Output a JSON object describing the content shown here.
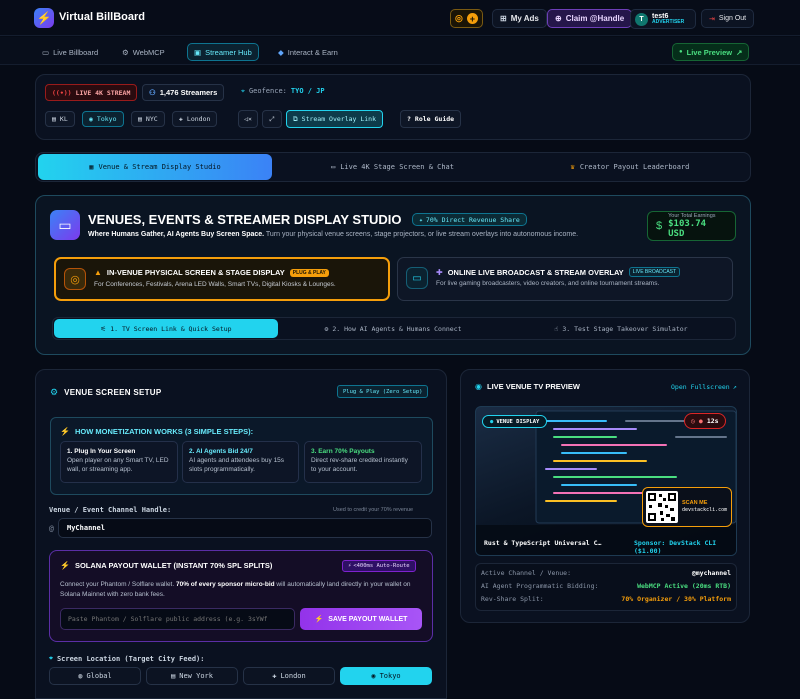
{
  "header": {
    "brand": "Virtual BillBoard",
    "my_ads": "My Ads",
    "claim": "Claim @Handle",
    "user_name": "test6",
    "user_role": "ADVERTISER",
    "user_initial": "T",
    "sign_out": "Sign Out"
  },
  "nav": {
    "items": [
      "Live Billboard",
      "WebMCP",
      "Streamer Hub",
      "Interact & Earn"
    ],
    "live_preview": "Live Preview"
  },
  "status": {
    "live": "LIVE 4K STREAM",
    "streamers": "1,476 Streamers",
    "geofence_label": "Geofence:",
    "geofence_value": "TYO / JP",
    "cities": [
      "KL",
      "Tokyo",
      "NYC",
      "London"
    ],
    "overlay_link": "Stream Overlay Link",
    "role_guide": "Role Guide"
  },
  "section_tabs": [
    "Venue & Stream Display Studio",
    "Live 4K Stage Screen & Chat",
    "Creator Payout Leaderboard"
  ],
  "studio": {
    "title": "VENUES, EVENTS & STREAMER DISPLAY STUDIO",
    "badge": "70% Direct Revenue Share",
    "subtitle_bold": "Where Humans Gather, AI Agents Buy Screen Space.",
    "subtitle_rest": " Turn your physical venue screens, stage projectors, or live stream overlays into autonomous income.",
    "earnings_label": "Your Total Earnings",
    "earnings_value": "$103.74 USD",
    "opt1_title": "IN-VENUE PHYSICAL SCREEN & STAGE DISPLAY",
    "opt1_badge": "PLUG & PLAY",
    "opt1_desc": "For Conferences, Festivals, Arena LED Walls, Smart TVs, Digital Kiosks & Lounges.",
    "opt2_title": "ONLINE LIVE BROADCAST & STREAM OVERLAY",
    "opt2_badge": "LIVE BROADCAST",
    "opt2_desc": "For live gaming broadcasters, video creators, and online tournament streams.",
    "steps": [
      "1. TV Screen Link & Quick Setup",
      "2. How AI Agents & Humans Connect",
      "3. Test Stage Takeover Simulator"
    ]
  },
  "setup": {
    "title": "VENUE SCREEN SETUP",
    "badge": "Plug & Play (Zero Setup)",
    "how_title": "HOW MONETIZATION WORKS (3 SIMPLE STEPS):",
    "steps": [
      {
        "title": "1. Plug In Your Screen",
        "desc": "Open player on any Smart TV, LED wall, or streaming app."
      },
      {
        "title": "2. AI Agents Bid 24/7",
        "desc": "AI agents and attendees buy 15s slots programmatically."
      },
      {
        "title": "3. Earn 70% Payouts",
        "desc": "Direct rev-share credited instantly to your account."
      }
    ],
    "handle_label": "Venue / Event Channel Handle:",
    "handle_hint": "Used to credit your 70% revenue",
    "handle_prefix": "@",
    "handle_value": "MyChannel",
    "wallet_title": "SOLANA PAYOUT WALLET (INSTANT 70% SPL SPLITS)",
    "wallet_badge": "<400ms Auto-Route",
    "wallet_desc_1": "Connect your Phantom / Solflare wallet. ",
    "wallet_desc_bold": "70% of every sponsor micro-bid",
    "wallet_desc_2": " will automatically land directly in your wallet on Solana Mainnet with zero bank fees.",
    "wallet_placeholder": "Paste Phantom / Solflare public address (e.g. 3sYWf",
    "save_wallet": "SAVE PAYOUT WALLET",
    "location_label": "Screen Location (Target City Feed):",
    "locations": [
      "Global",
      "New York",
      "London",
      "Tokyo"
    ]
  },
  "preview": {
    "title": "LIVE VENUE TV PREVIEW",
    "open_fullscreen": "Open Fullscreen",
    "venue_display": "VENUE DISPLAY",
    "timer": "12s",
    "scan_me": "SCAN ME",
    "scan_url": "devstackcli.com",
    "ad_title": "Rust & TypeScript Universal C…",
    "ad_sponsor": "Sponsor: DevStack CLI ($1.00)",
    "rows": [
      {
        "label": "Active Channel / Venue:",
        "value": "@mychannel"
      },
      {
        "label": "AI Agent Programmatic Bidding:",
        "value": "WebMCP Active (20ms RTB)"
      },
      {
        "label": "Rev-Share Split:",
        "value": "70% Organizer / 30% Platform"
      }
    ]
  },
  "colors": {
    "accent": "#22d3ee",
    "purple": "#a855f7",
    "gold": "#f59e0b",
    "live_red": "#ef4444",
    "green": "#22c55e"
  }
}
